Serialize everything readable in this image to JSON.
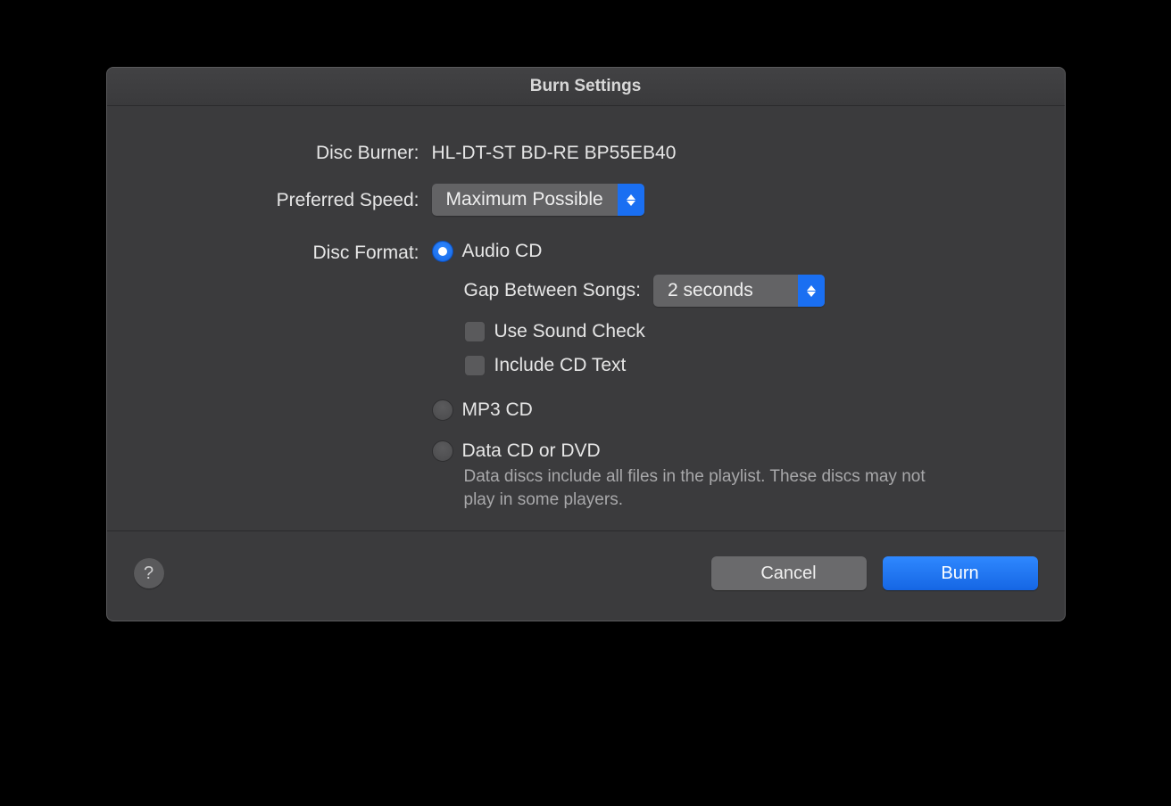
{
  "title": "Burn Settings",
  "labels": {
    "disc_burner": "Disc Burner:",
    "preferred_speed": "Preferred Speed:",
    "disc_format": "Disc Format:",
    "gap_between_songs": "Gap Between Songs:"
  },
  "disc_burner_value": "HL-DT-ST BD-RE BP55EB40",
  "preferred_speed_value": "Maximum Possible",
  "gap_value": "2 seconds",
  "format_options": {
    "audio_cd": "Audio CD",
    "mp3_cd": "MP3 CD",
    "data_cd": "Data CD or DVD"
  },
  "checkboxes": {
    "use_sound_check": "Use Sound Check",
    "include_cd_text": "Include CD Text"
  },
  "data_cd_description": "Data discs include all files in the playlist. These discs may not play in some players.",
  "buttons": {
    "cancel": "Cancel",
    "burn": "Burn"
  },
  "help_glyph": "?"
}
